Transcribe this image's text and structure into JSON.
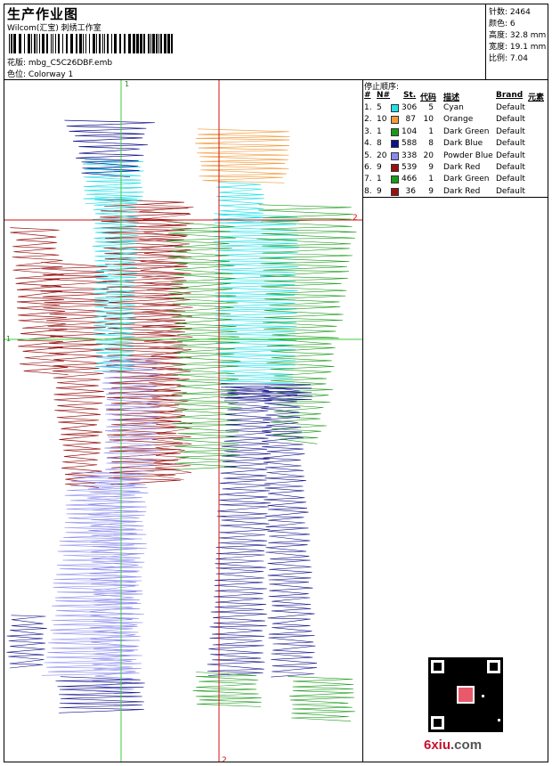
{
  "header": {
    "title": "生产作业图",
    "company": "Wilcom(汇宝) 刺绣工作室",
    "file_label": "花版: ",
    "file_name": "mbg_C5C26DBF.emb",
    "colorway_label": "色位: ",
    "colorway": "Colorway 1"
  },
  "stats": {
    "stitches": "针数: 2464",
    "colors": "颜色: 6",
    "height": "高度: 32.8 mm",
    "width": "宽度: 19.1 mm",
    "scale": "比例: 7.04"
  },
  "stop_sequence": {
    "title": "停止顺序:",
    "columns": [
      "#",
      "N#",
      "St.",
      "代码",
      "描述",
      "Brand",
      "元素"
    ],
    "rows": [
      {
        "idx": "1.",
        "n": "5",
        "color": "#22e0e8",
        "st": "306",
        "code": "5",
        "desc": "Cyan",
        "brand": "Default"
      },
      {
        "idx": "2.",
        "n": "10",
        "color": "#f29a3c",
        "st": "87",
        "code": "10",
        "desc": "Orange",
        "brand": "Default"
      },
      {
        "idx": "3.",
        "n": "1",
        "color": "#1a9a1a",
        "st": "104",
        "code": "1",
        "desc": "Dark Green",
        "brand": "Default"
      },
      {
        "idx": "4.",
        "n": "8",
        "color": "#10108a",
        "st": "588",
        "code": "8",
        "desc": "Dark Blue",
        "brand": "Default"
      },
      {
        "idx": "5.",
        "n": "20",
        "color": "#8a8aee",
        "st": "338",
        "code": "20",
        "desc": "Powder Blue",
        "brand": "Default"
      },
      {
        "idx": "6.",
        "n": "9",
        "color": "#9a1010",
        "st": "539",
        "code": "9",
        "desc": "Dark Red",
        "brand": "Default"
      },
      {
        "idx": "7.",
        "n": "1",
        "color": "#1a9a1a",
        "st": "466",
        "code": "1",
        "desc": "Dark Green",
        "brand": "Default"
      },
      {
        "idx": "8.",
        "n": "9",
        "color": "#9a1010",
        "st": "36",
        "code": "9",
        "desc": "Dark Red",
        "brand": "Default"
      }
    ]
  },
  "canvas": {
    "guide_labels": {
      "top": "1",
      "right": "2",
      "left": "1",
      "bottom": "2"
    },
    "colors": {
      "guide_green": "#3ccc3c",
      "guide_red": "#d01010"
    }
  },
  "watermark": {
    "brand_red": "6xiu",
    "brand_grey": ".com"
  }
}
